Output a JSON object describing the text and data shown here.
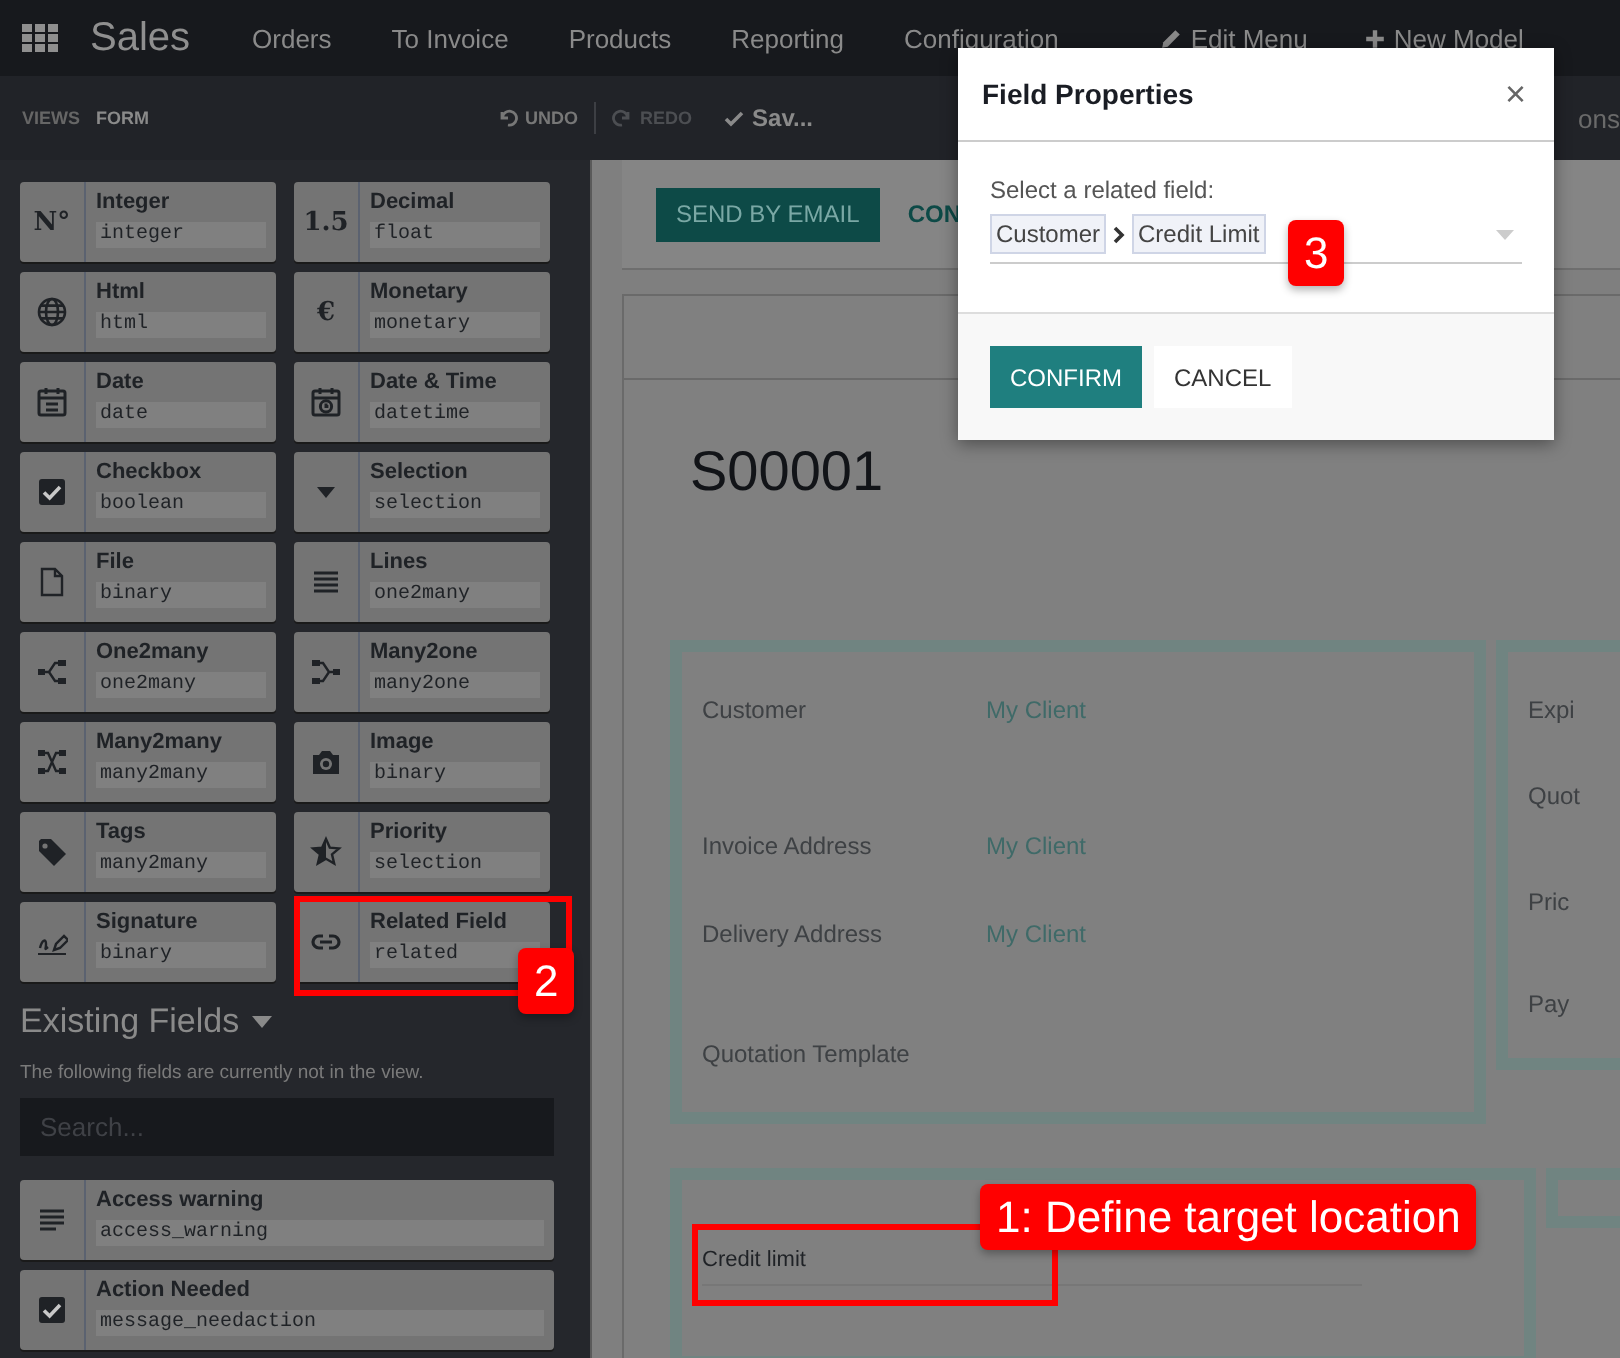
{
  "app": {
    "name": "Sales"
  },
  "nav": [
    "Orders",
    "To Invoice",
    "Products",
    "Reporting",
    "Configuration"
  ],
  "nav_actions": [
    {
      "label": "Edit Menu",
      "kind": "edit"
    },
    {
      "label": "New Model",
      "kind": "add"
    }
  ],
  "toolbar": {
    "views_label": "VIEWS",
    "current_view": "FORM",
    "actions": [
      {
        "label": "UNDO",
        "kind": "undo",
        "disabled": false
      },
      {
        "label": "REDO",
        "kind": "redo",
        "disabled": true
      },
      {
        "label": "Sav...",
        "kind": "save",
        "disabled": false
      }
    ],
    "cut_text": "ons"
  },
  "field_types": [
    {
      "label": "Integer",
      "tech": "integer",
      "kind": "integer",
      "icon_text": "N°"
    },
    {
      "label": "Decimal",
      "tech": "float",
      "kind": "decimal",
      "icon_text": "1.5"
    },
    {
      "label": "Html",
      "tech": "html",
      "kind": "html"
    },
    {
      "label": "Monetary",
      "tech": "monetary",
      "kind": "monetary",
      "icon_text": "€"
    },
    {
      "label": "Date",
      "tech": "date",
      "kind": "date"
    },
    {
      "label": "Date & Time",
      "tech": "datetime",
      "kind": "datetime"
    },
    {
      "label": "Checkbox",
      "tech": "boolean",
      "kind": "checkbox"
    },
    {
      "label": "Selection",
      "tech": "selection",
      "kind": "selection"
    },
    {
      "label": "File",
      "tech": "binary",
      "kind": "file"
    },
    {
      "label": "Lines",
      "tech": "one2many",
      "kind": "lines"
    },
    {
      "label": "One2many",
      "tech": "one2many",
      "kind": "one2many"
    },
    {
      "label": "Many2one",
      "tech": "many2one",
      "kind": "many2one"
    },
    {
      "label": "Many2many",
      "tech": "many2many",
      "kind": "many2many"
    },
    {
      "label": "Image",
      "tech": "binary",
      "kind": "image"
    },
    {
      "label": "Tags",
      "tech": "many2many",
      "kind": "tags"
    },
    {
      "label": "Priority",
      "tech": "selection",
      "kind": "priority"
    },
    {
      "label": "Signature",
      "tech": "binary",
      "kind": "signature"
    },
    {
      "label": "Related Field",
      "tech": "related",
      "kind": "related"
    }
  ],
  "existing_fields": {
    "title": "Existing Fields",
    "note": "The following fields are currently not in the view.",
    "search": {
      "placeholder": "Search..."
    },
    "items": [
      {
        "label": "Access warning",
        "tech": "access_warning",
        "kind": "text"
      },
      {
        "label": "Action Needed",
        "tech": "message_needaction",
        "kind": "checkbox"
      }
    ]
  },
  "form": {
    "buttons": [
      {
        "label": "SEND BY EMAIL",
        "kind": "primary"
      },
      {
        "label": "CON",
        "kind": "secondary"
      }
    ],
    "name": "S00001",
    "fields": [
      {
        "label": "Customer",
        "value": "My Client"
      },
      {
        "label": "Invoice Address",
        "value": "My Client"
      },
      {
        "label": "Delivery Address",
        "value": "My Client"
      },
      {
        "label": "Quotation Template"
      }
    ],
    "side_fields": [
      "Expi",
      "Quot",
      "Pric",
      "Pay"
    ],
    "new_field": {
      "label": "Credit limit"
    }
  },
  "dialog": {
    "title": "Field Properties",
    "close": "×",
    "prompt": "Select a related field:",
    "path": [
      "Customer",
      "Credit Limit"
    ],
    "buttons": [
      {
        "label": "CONFIRM",
        "kind": "primary"
      },
      {
        "label": "CANCEL",
        "kind": "secondary"
      }
    ]
  },
  "annotations": [
    {
      "label": "1: Define target location"
    },
    {
      "label": "2"
    },
    {
      "label": "3"
    }
  ]
}
